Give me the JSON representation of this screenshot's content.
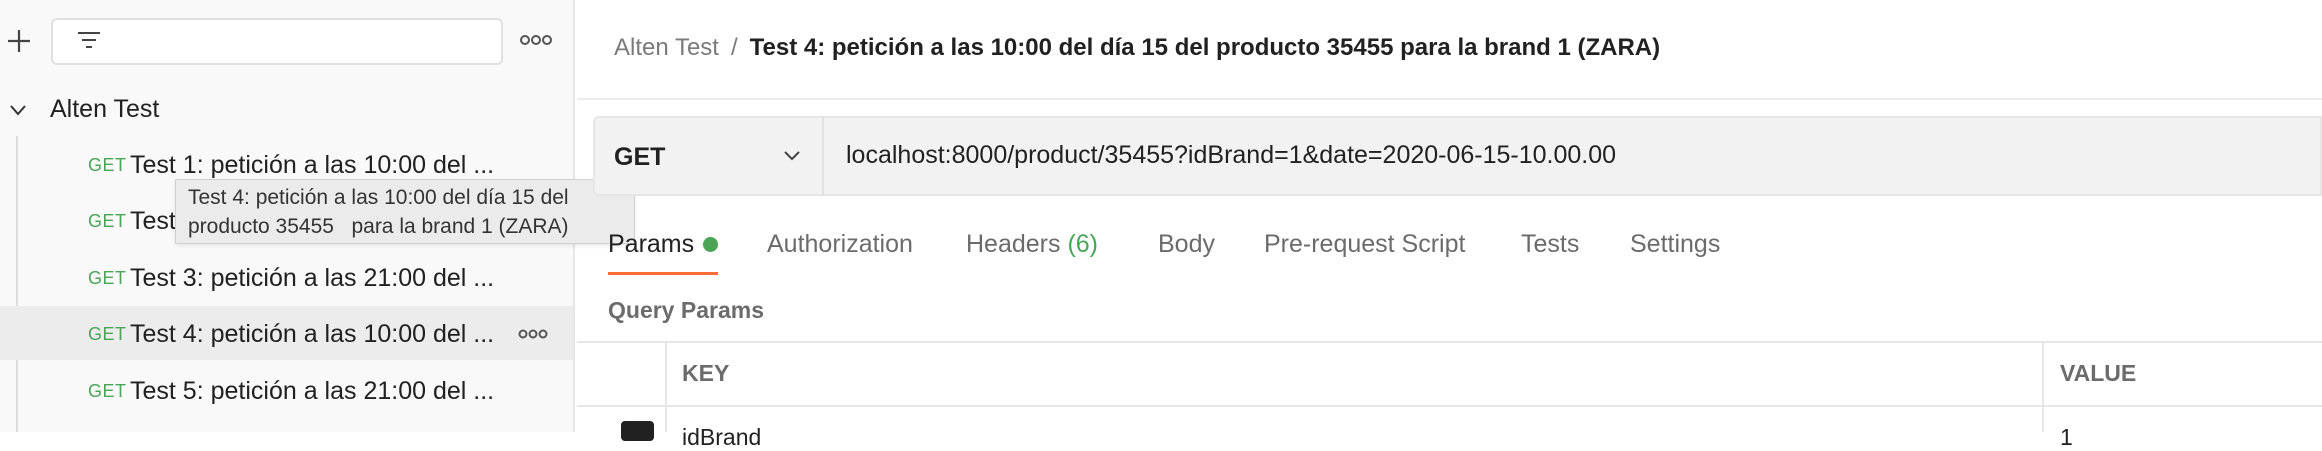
{
  "sidebar": {
    "collection": "Alten Test",
    "requests": [
      {
        "method": "GET",
        "label": "Test 1: petición a las 10:00 del ..."
      },
      {
        "method": "GET",
        "label": "Test"
      },
      {
        "method": "GET",
        "label": "Test 3: petición a las 21:00 del ..."
      },
      {
        "method": "GET",
        "label": "Test 4: petición a las 10:00 del ..."
      },
      {
        "method": "GET",
        "label": "Test 5: petición a las 21:00 del ..."
      }
    ],
    "tooltip": "Test 4: petición a las 10:00 del día 15 del\nproducto 35455   para la brand 1 (ZARA)"
  },
  "breadcrumb": {
    "parent": "Alten Test",
    "separator": "/",
    "current": "Test 4: petición a las 10:00 del día 15 del producto 35455 para la brand 1 (ZARA)"
  },
  "request": {
    "method": "GET",
    "url": "localhost:8000/product/35455?idBrand=1&date=2020-06-15-10.00.00"
  },
  "tabs": {
    "params": "Params",
    "authorization": "Authorization",
    "headers": "Headers",
    "headers_count": "(6)",
    "body": "Body",
    "prerequest": "Pre-request Script",
    "tests": "Tests",
    "settings": "Settings"
  },
  "query_params": {
    "title": "Query Params",
    "columns": {
      "key": "KEY",
      "value": "VALUE"
    },
    "rows": [
      {
        "key": "idBrand",
        "value": "1"
      }
    ]
  },
  "colors": {
    "method_get": "#4aa557",
    "accent": "#ff6c37"
  }
}
